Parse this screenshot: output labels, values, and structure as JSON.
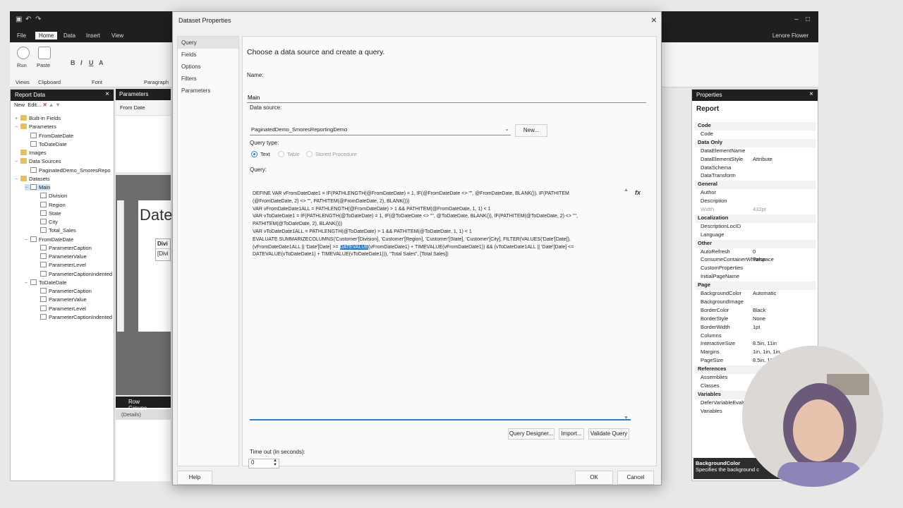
{
  "app": {
    "ribbon_tabs": [
      "File",
      "Home",
      "Data",
      "Insert",
      "View"
    ],
    "user_name": "Lenore Flower",
    "ribbon": {
      "run_label": "Run",
      "paste_label": "Paste",
      "views_label": "Views",
      "clipboard_label": "Clipboard",
      "font_label": "Font",
      "paragraph_label": "Paragraph"
    }
  },
  "report_data": {
    "title": "Report Data",
    "toolbar_new": "New",
    "toolbar_edit": "Edit...",
    "tree": [
      {
        "label": "Built-in Fields",
        "type": "folder",
        "level": 0,
        "expander": "+"
      },
      {
        "label": "Parameters",
        "type": "folder",
        "level": 0,
        "expander": "−"
      },
      {
        "label": "FromDateDate",
        "type": "doc",
        "level": 1
      },
      {
        "label": "ToDateDate",
        "type": "doc",
        "level": 1
      },
      {
        "label": "Images",
        "type": "folder",
        "level": 0
      },
      {
        "label": "Data Sources",
        "type": "folder",
        "level": 0,
        "expander": "−"
      },
      {
        "label": "PaginatedDemo_SmoresRepo",
        "type": "doc",
        "level": 1
      },
      {
        "label": "Datasets",
        "type": "folder",
        "level": 0,
        "expander": "−"
      },
      {
        "label": "Main",
        "type": "doc",
        "level": 1,
        "expander": "−",
        "selected": true
      },
      {
        "label": "Division",
        "type": "doc",
        "level": 2
      },
      {
        "label": "Region",
        "type": "doc",
        "level": 2
      },
      {
        "label": "State",
        "type": "doc",
        "level": 2
      },
      {
        "label": "City",
        "type": "doc",
        "level": 2
      },
      {
        "label": "Total_Sales",
        "type": "doc",
        "level": 2
      },
      {
        "label": "FromDateDate",
        "type": "doc",
        "level": 1,
        "expander": "−"
      },
      {
        "label": "ParameterCaption",
        "type": "doc",
        "level": 2
      },
      {
        "label": "ParameterValue",
        "type": "doc",
        "level": 2
      },
      {
        "label": "ParameterLevel",
        "type": "doc",
        "level": 2
      },
      {
        "label": "ParameterCaptionIndented",
        "type": "doc",
        "level": 2
      },
      {
        "label": "ToDateDate",
        "type": "doc",
        "level": 1,
        "expander": "−"
      },
      {
        "label": "ParameterCaption",
        "type": "doc",
        "level": 2
      },
      {
        "label": "ParameterValue",
        "type": "doc",
        "level": 2
      },
      {
        "label": "ParameterLevel",
        "type": "doc",
        "level": 2
      },
      {
        "label": "ParameterCaptionIndented",
        "type": "doc",
        "level": 2
      }
    ]
  },
  "canvas": {
    "parameters_title": "Parameters",
    "from_date_label": "From Date",
    "report_title_fragment": "Date",
    "table_header_fragment": "Divi",
    "table_cell_fragment": "[Divi",
    "row_groups_title": "Row Groups",
    "details_label": "(Details)"
  },
  "properties": {
    "title": "Properties",
    "object": "Report",
    "rows": [
      {
        "k": "Code",
        "cat": true
      },
      {
        "k": "Code",
        "v": ""
      },
      {
        "k": "Data Only",
        "cat": true
      },
      {
        "k": "DataElementName",
        "v": ""
      },
      {
        "k": "DataElementStyle",
        "v": "Attribute"
      },
      {
        "k": "DataSchema",
        "v": ""
      },
      {
        "k": "DataTransform",
        "v": ""
      },
      {
        "k": "General",
        "cat": true
      },
      {
        "k": "Author",
        "v": ""
      },
      {
        "k": "Description",
        "v": ""
      },
      {
        "k": "Width",
        "v": "432pt",
        "dim": true
      },
      {
        "k": "Localization",
        "cat": true
      },
      {
        "k": "DescriptionLocID",
        "v": ""
      },
      {
        "k": "Language",
        "v": ""
      },
      {
        "k": "Other",
        "cat": true
      },
      {
        "k": "AutoRefresh",
        "v": "0"
      },
      {
        "k": "ConsumeContainerWhitespace",
        "v": "False"
      },
      {
        "k": "CustomProperties",
        "v": ""
      },
      {
        "k": "InitialPageName",
        "v": ""
      },
      {
        "k": "Page",
        "cat": true
      },
      {
        "k": "BackgroundColor",
        "v": "Automatic"
      },
      {
        "k": "BackgroundImage",
        "v": ""
      },
      {
        "k": "BorderColor",
        "v": "Black"
      },
      {
        "k": "BorderStyle",
        "v": "None"
      },
      {
        "k": "BorderWidth",
        "v": "1pt"
      },
      {
        "k": "Columns",
        "v": ""
      },
      {
        "k": "InteractiveSize",
        "v": "8.5in, 11in"
      },
      {
        "k": "Margins",
        "v": "1in, 1in, 1in,"
      },
      {
        "k": "PageSize",
        "v": "8.5in, 11"
      },
      {
        "k": "References",
        "cat": true
      },
      {
        "k": "Assemblies",
        "v": ""
      },
      {
        "k": "Classes",
        "v": ""
      },
      {
        "k": "Variables",
        "cat": true
      },
      {
        "k": "DeferVariableEvalu",
        "v": ""
      },
      {
        "k": "Variables",
        "v": ""
      }
    ],
    "desc_title": "BackgroundColor",
    "desc_text": "Specifies the background c"
  },
  "dialog": {
    "title": "Dataset Properties",
    "nav": [
      "Query",
      "Fields",
      "Options",
      "Filters",
      "Parameters"
    ],
    "heading": "Choose a data source and create a query.",
    "name_label": "Name:",
    "name_value": "Main",
    "datasource_label": "Data source:",
    "datasource_value": "PaginatedDemo_SmoresReportingDemo",
    "new_button": "New...",
    "query_type_label": "Query type:",
    "query_types": [
      "Text",
      "Table",
      "Stored Procedure"
    ],
    "query_label": "Query:",
    "query_before": "DEFINE VAR vFromDateDate1 = IF(PATHLENGTH(@FromDateDate) = 1, IF(@FromDateDate <> \"\", @FromDateDate, BLANK()), IF(PATHITEM\n(@FromDateDate, 2) <> \"\", PATHITEM(@FromDateDate, 2), BLANK()))\nVAR vFromDateDate1ALL = PATHLENGTH(@FromDateDate) > 1 && PATHITEM(@FromDateDate, 1, 1) < 1\nVAR vToDateDate1 = IF(PATHLENGTH(@ToDateDate) = 1, IF(@ToDateDate <> \"\", @ToDateDate, BLANK()), IF(PATHITEM(@ToDateDate, 2) <> \"\",\nPATHITEM(@ToDateDate, 2), BLANK()))\nVAR vToDateDate1ALL = PATHLENGTH(@ToDateDate) > 1 && PATHITEM(@ToDateDate, 1, 1) < 1\nEVALUATE SUMMARIZECOLUMNS('Customer'[Division], 'Customer'[Region], 'Customer'[State], 'Customer'[City], FILTER(VALUES('Date'[Date]),\n(vFromDateDate1ALL || 'Date'[Date] >= ",
    "query_highlight": "DATEVALUE",
    "query_after": "(vFromDateDate1) + TIMEVALUE(vFromDateDate1)) && (vToDateDate1ALL || 'Date'[Date] <=\nDATEVALUE(vToDateDate1) + TIMEVALUE(vToDateDate1))), \"Total Sales\", [Total Sales])",
    "fx_label": "fx",
    "query_designer_button": "Query Designer...",
    "import_button": "Import...",
    "validate_button": "Validate Query",
    "timeout_label": "Time out (in seconds):",
    "timeout_value": "0",
    "help_button": "Help",
    "ok_button": "OK",
    "cancel_button": "Cancel"
  },
  "colors": {
    "accent": "#2b7cd3",
    "dark_chrome": "#1f1f1f"
  }
}
